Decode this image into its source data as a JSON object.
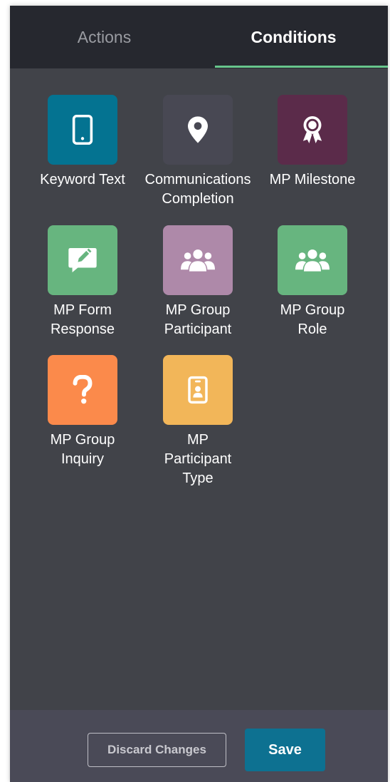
{
  "tabs": {
    "actions_label": "Actions",
    "conditions_label": "Conditions",
    "active": "Conditions"
  },
  "conditions": [
    {
      "label": "Keyword Text",
      "icon": "phone-icon",
      "color": "#047391"
    },
    {
      "label": "Communications\nCompletion",
      "icon": "map-pin-icon",
      "color": "#484853"
    },
    {
      "label": "MP Milestone",
      "icon": "award-ribbon-icon",
      "color": "#5b2b4a"
    },
    {
      "label": "MP Form\nResponse",
      "icon": "pencil-comment-icon",
      "color": "#67b57f"
    },
    {
      "label": "MP Group\nParticipant",
      "icon": "users-group-icon",
      "color": "#ae89a9"
    },
    {
      "label": "MP Group\nRole",
      "icon": "users-group-icon",
      "color": "#67b57f"
    },
    {
      "label": "MP Group\nInquiry",
      "icon": "question-mark-icon",
      "color": "#fb8a4b"
    },
    {
      "label": "MP\nParticipant\nType",
      "icon": "id-badge-icon",
      "color": "#f2b659"
    }
  ],
  "footer": {
    "discard_label": "Discard Changes",
    "save_label": "Save"
  }
}
